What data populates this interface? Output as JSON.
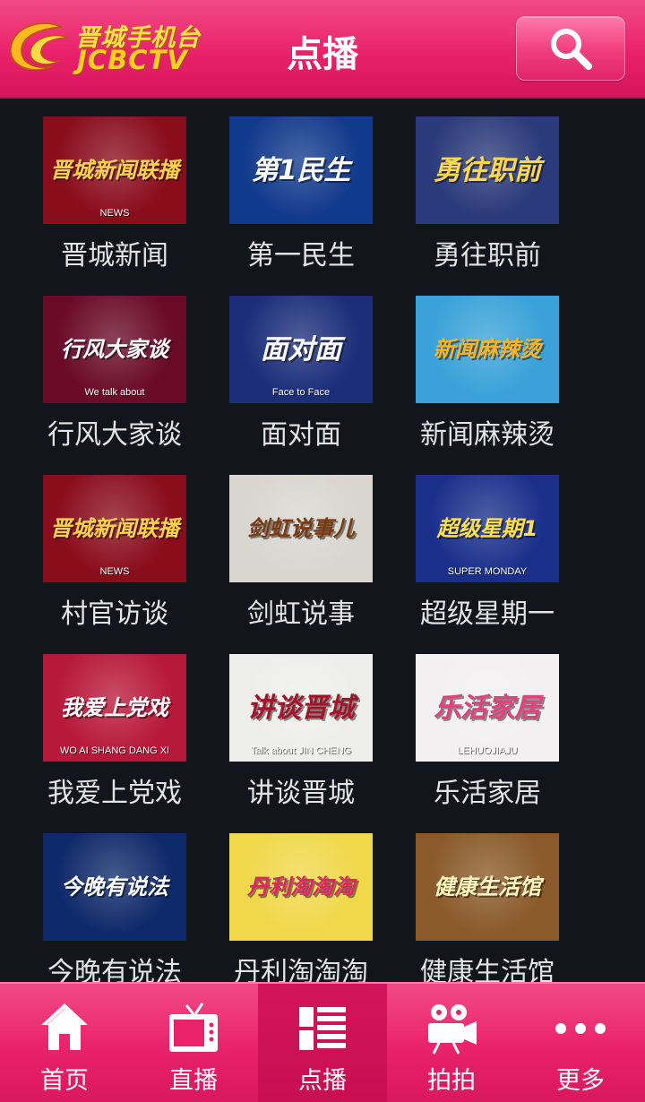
{
  "header": {
    "logo_cn": "晋城手机台",
    "logo_en": "JCBCTV",
    "title": "点播",
    "search_icon": "search-icon"
  },
  "programs": [
    {
      "label": "晋城新闻",
      "thumb_text": "晋城新闻联播",
      "thumb_sub": "NEWS",
      "bg": "#8a0d1c",
      "fg": "#ffd34a"
    },
    {
      "label": "第一民生",
      "thumb_text": "第1民生",
      "thumb_sub": "",
      "bg": "#123a8c",
      "fg": "#ffffff"
    },
    {
      "label": "勇往职前",
      "thumb_text": "勇往职前",
      "thumb_sub": "",
      "bg": "#2a3a7a",
      "fg": "#ffd84a"
    },
    {
      "label": "行风大家谈",
      "thumb_text": "行风大家谈",
      "thumb_sub": "We talk about",
      "bg": "#6a0b2a",
      "fg": "#ffffff"
    },
    {
      "label": "面对面",
      "thumb_text": "面对面",
      "thumb_sub": "Face to Face",
      "bg": "#1c2e7a",
      "fg": "#ffffff"
    },
    {
      "label": "新闻麻辣烫",
      "thumb_text": "新闻麻辣烫",
      "thumb_sub": "",
      "bg": "#3aa2d8",
      "fg": "#ffb320"
    },
    {
      "label": "村官访谈",
      "thumb_text": "晋城新闻联播",
      "thumb_sub": "NEWS",
      "bg": "#8a0d1c",
      "fg": "#ffd34a"
    },
    {
      "label": "剑虹说事",
      "thumb_text": "剑虹说事儿",
      "thumb_sub": "",
      "bg": "#d9d6d0",
      "fg": "#7a3a10"
    },
    {
      "label": "超级星期一",
      "thumb_text": "超级星期1",
      "thumb_sub": "SUPER MONDAY",
      "bg": "#1a2f8a",
      "fg": "#ffe04a"
    },
    {
      "label": "我爱上党戏",
      "thumb_text": "我爱上党戏",
      "thumb_sub": "WO AI SHANG DANG XI",
      "bg": "#b8193a",
      "fg": "#ffffff"
    },
    {
      "label": "讲谈晋城",
      "thumb_text": "讲谈晋城",
      "thumb_sub": "Talk about JIN CHENG",
      "bg": "#eeeeea",
      "fg": "#a3132a"
    },
    {
      "label": "乐活家居",
      "thumb_text": "乐活家居",
      "thumb_sub": "LEHUOJIAJU",
      "bg": "#f2f0f0",
      "fg": "#e2427a"
    },
    {
      "label": "今晚有说法",
      "thumb_text": "今晚有说法",
      "thumb_sub": "",
      "bg": "#0f2a6a",
      "fg": "#ffffff"
    },
    {
      "label": "丹利淘淘淘",
      "thumb_text": "丹利淘淘淘",
      "thumb_sub": "",
      "bg": "#f0d84a",
      "fg": "#e0246a"
    },
    {
      "label": "健康生活馆",
      "thumb_text": "健康生活馆",
      "thumb_sub": "",
      "bg": "#8a5a2a",
      "fg": "#fff6c0"
    }
  ],
  "tabs": [
    {
      "label": "首页",
      "icon": "home-icon",
      "active": false
    },
    {
      "label": "直播",
      "icon": "tv-icon",
      "active": false
    },
    {
      "label": "点播",
      "icon": "list-icon",
      "active": true
    },
    {
      "label": "拍拍",
      "icon": "video-camera-icon",
      "active": false
    },
    {
      "label": "更多",
      "icon": "more-icon",
      "active": false
    }
  ],
  "colors": {
    "accent": "#e9226a",
    "background": "#12151c",
    "label": "#e4e4e4"
  }
}
